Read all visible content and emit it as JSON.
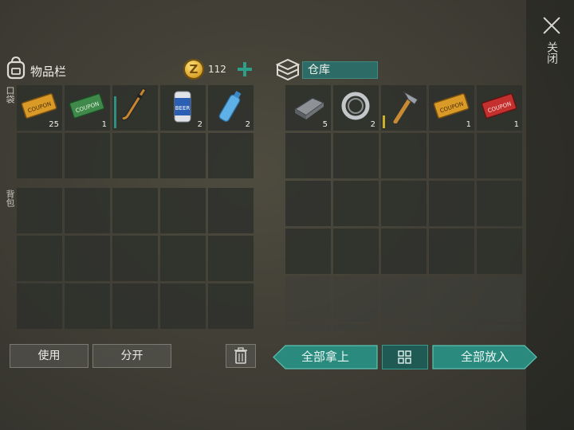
{
  "close": {
    "label": "关闭"
  },
  "inventory": {
    "title": "物品栏",
    "coins": "112",
    "coin_symbol": "Z",
    "pocket_label": "口袋",
    "backpack_label": "背包",
    "pocket_items": [
      {
        "name": "coupon-orange",
        "qty": "25",
        "coupon_text": "COUPON"
      },
      {
        "name": "coupon-green",
        "qty": "1",
        "coupon_text": "COUPON"
      },
      {
        "name": "hockey-stick",
        "qty": ""
      },
      {
        "name": "beer-can",
        "qty": "2",
        "can_text": "BEER"
      },
      {
        "name": "water-bottle",
        "qty": "2"
      }
    ]
  },
  "storage": {
    "name": "仓库",
    "items": [
      {
        "name": "metal-ingot",
        "qty": "5"
      },
      {
        "name": "bearing",
        "qty": "2"
      },
      {
        "name": "hammer",
        "qty": ""
      },
      {
        "name": "coupon-orange",
        "qty": "1",
        "coupon_text": "COUPON"
      },
      {
        "name": "coupon-red",
        "qty": "1",
        "coupon_text": "COUPON"
      }
    ]
  },
  "buttons": {
    "use": "使用",
    "split": "分开",
    "take_all": "全部拿上",
    "put_all": "全部放入"
  },
  "colors": {
    "accent_teal": "#2f9e88",
    "panel_cell": "#2e302c",
    "wear_bar": "#2f8f80"
  }
}
